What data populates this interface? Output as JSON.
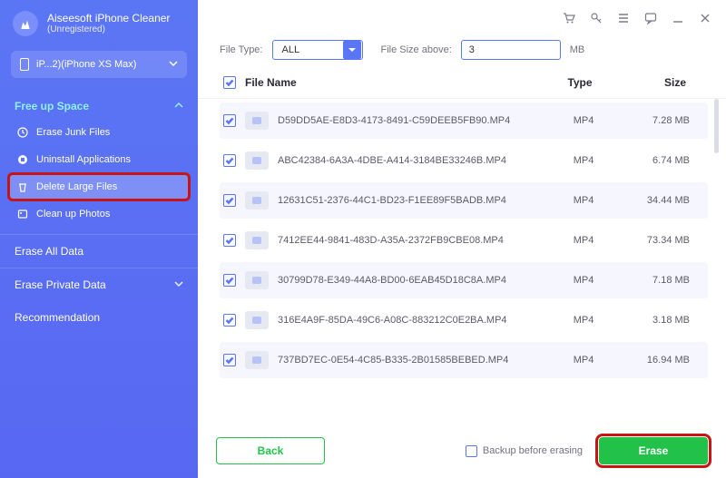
{
  "brand": {
    "title": "Aiseesoft iPhone",
    "subtitle": "Cleaner",
    "registration": "(Unregistered)"
  },
  "device": {
    "label": "iP...2)(iPhone XS Max)"
  },
  "sidebar": {
    "section_free": "Free up Space",
    "items": [
      {
        "label": "Erase Junk Files"
      },
      {
        "label": "Uninstall Applications"
      },
      {
        "label": "Delete Large Files"
      },
      {
        "label": "Clean up Photos"
      }
    ],
    "erase_all": "Erase All Data",
    "erase_private": "Erase Private Data",
    "recommendation": "Recommendation"
  },
  "filters": {
    "file_type_label": "File Type:",
    "file_type_value": "ALL",
    "file_size_label": "File Size above:",
    "file_size_value": "3",
    "unit": "MB"
  },
  "columns": {
    "name": "File Name",
    "type": "Type",
    "size": "Size"
  },
  "files": [
    {
      "name": "D59DD5AE-E8D3-4173-8491-C59DEEB5FB90.MP4",
      "type": "MP4",
      "size": "7.28 MB"
    },
    {
      "name": "ABC42384-6A3A-4DBE-A414-3184BE33246B.MP4",
      "type": "MP4",
      "size": "6.74 MB"
    },
    {
      "name": "12631C51-2376-44C1-BD23-F1EE89F5BADB.MP4",
      "type": "MP4",
      "size": "34.44 MB"
    },
    {
      "name": "7412EE44-9841-483D-A35A-2372FB9CBE08.MP4",
      "type": "MP4",
      "size": "73.34 MB"
    },
    {
      "name": "30799D78-E349-44A8-BD00-6EAB45D18C8A.MP4",
      "type": "MP4",
      "size": "7.18 MB"
    },
    {
      "name": "316E4A9F-85DA-49C6-A08C-883212C0E2BA.MP4",
      "type": "MP4",
      "size": "3.18 MB"
    },
    {
      "name": "737BD7EC-0E54-4C85-B335-2B01585BEBED.MP4",
      "type": "MP4",
      "size": "16.94 MB"
    }
  ],
  "footer": {
    "back": "Back",
    "backup": "Backup before erasing",
    "erase": "Erase"
  }
}
